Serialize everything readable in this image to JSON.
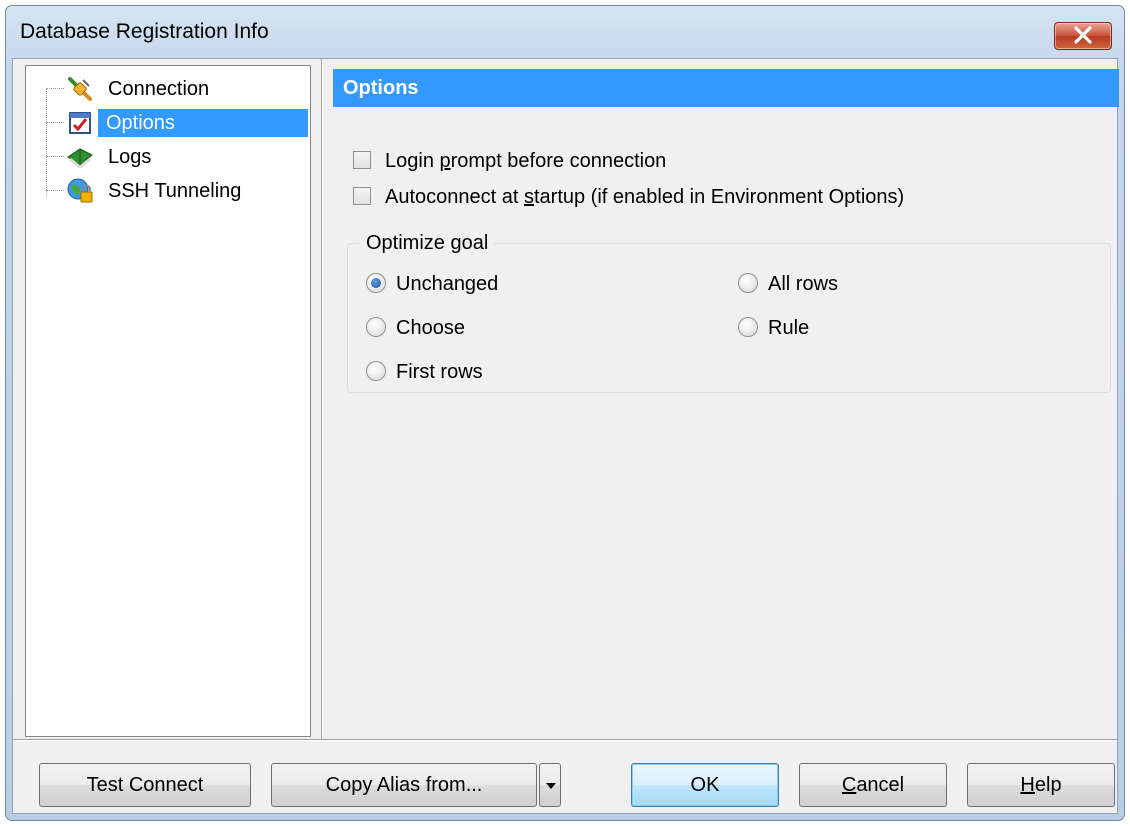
{
  "window": {
    "title": "Database Registration Info"
  },
  "tree": {
    "items": [
      {
        "label": "Connection",
        "icon": "connection-plug-icon",
        "selected": false
      },
      {
        "label": "Options",
        "icon": "options-checklist-icon",
        "selected": true
      },
      {
        "label": "Logs",
        "icon": "logs-book-icon",
        "selected": false
      },
      {
        "label": "SSH Tunneling",
        "icon": "ssh-globe-lock-icon",
        "selected": false
      }
    ]
  },
  "options": {
    "header": "Options",
    "checkboxes": [
      {
        "label_pre": "Login ",
        "label_ul": "p",
        "label_post": "rompt before connection",
        "checked": false
      },
      {
        "label_pre": "Autoconnect at ",
        "label_ul": "s",
        "label_post": "tartup (if enabled in Environment Options)",
        "checked": false
      }
    ],
    "optimize_goal": {
      "title": "Optimize goal",
      "choices": [
        "Unchanged",
        "All rows",
        "Choose",
        "Rule",
        "First rows"
      ],
      "selected": "Unchanged"
    }
  },
  "buttons": {
    "test_connect": "Test Connect",
    "copy_alias": "Copy Alias from...",
    "ok": "OK",
    "cancel_ul": "C",
    "cancel_rest": "ancel",
    "help_ul": "H",
    "help_rest": "elp"
  },
  "colors": {
    "selection": "#3399ff",
    "header": "#3399ff",
    "close": "#c9513a"
  }
}
